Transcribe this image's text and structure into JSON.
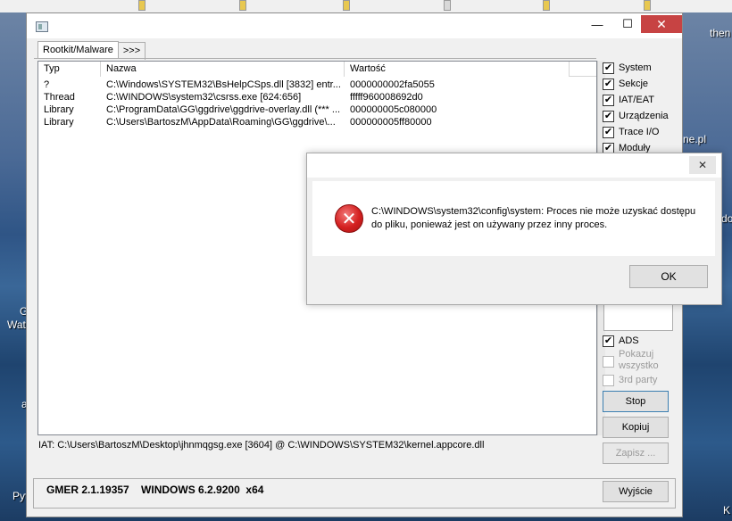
{
  "desktop": {
    "label_right_top": "then",
    "label_right_mid": "ne.pl",
    "label_right_lower": "do",
    "label_left_1": "G",
    "label_left_2": "Wat",
    "label_left_3": "a",
    "label_left_4": "Pyt",
    "label_right_bottom": "K"
  },
  "window": {
    "title_buttons": {
      "minimize": "—",
      "maximize": "☐",
      "close": "✕"
    },
    "tabs": [
      {
        "label": "Rootkit/Malware"
      },
      {
        "label": ">>>"
      }
    ],
    "list": {
      "columns": [
        "Typ",
        "Nazwa",
        "Wartość"
      ],
      "rows": [
        {
          "typ": "?",
          "nazwa": "C:\\Windows\\SYSTEM32\\BsHelpCSps.dll [3832] entr...",
          "wartosc": "0000000002fa5055"
        },
        {
          "typ": "Thread",
          "nazwa": "C:\\WINDOWS\\system32\\csrss.exe [624:656]",
          "wartosc": "fffff960008692d0"
        },
        {
          "typ": "Library",
          "nazwa": "C:\\ProgramData\\GG\\ggdrive\\ggdrive-overlay.dll (*** ...",
          "wartosc": "000000005c080000"
        },
        {
          "typ": "Library",
          "nazwa": "C:\\Users\\BartoszM\\AppData\\Roaming\\GG\\ggdrive\\...",
          "wartosc": "000000005ff80000"
        }
      ]
    },
    "options": [
      {
        "label": "System",
        "checked": true
      },
      {
        "label": "Sekcje",
        "checked": true
      },
      {
        "label": "IAT/EAT",
        "checked": true
      },
      {
        "label": "Urządzenia",
        "checked": true
      },
      {
        "label": "Trace I/O",
        "checked": true
      },
      {
        "label": "Moduły",
        "checked": true
      }
    ],
    "options_lower": {
      "ads": {
        "label": "ADS",
        "checked": true
      },
      "show_all": {
        "label_1": "Pokazuj",
        "label_2": "wszystko",
        "checked": false
      },
      "third_party": {
        "label": "3rd party",
        "checked": false
      }
    },
    "buttons": {
      "stop": "Stop",
      "copy": "Kopiuj",
      "save": "Zapisz ...",
      "exit": "Wyjście"
    },
    "status": "IAT: C:\\Users\\BartoszM\\Desktop\\jhnmqgsg.exe [3604] @ C:\\WINDOWS\\SYSTEM32\\kernel.appcore.dll",
    "footer": "GMER 2.1.19357    WINDOWS 6.2.9200  x64"
  },
  "dialog": {
    "close": "✕",
    "icon": "error-icon",
    "message": "C:\\WINDOWS\\system32\\config\\system: Proces nie może uzyskać dostępu do pliku, ponieważ jest on używany przez inny proces.",
    "ok_label": "OK"
  }
}
